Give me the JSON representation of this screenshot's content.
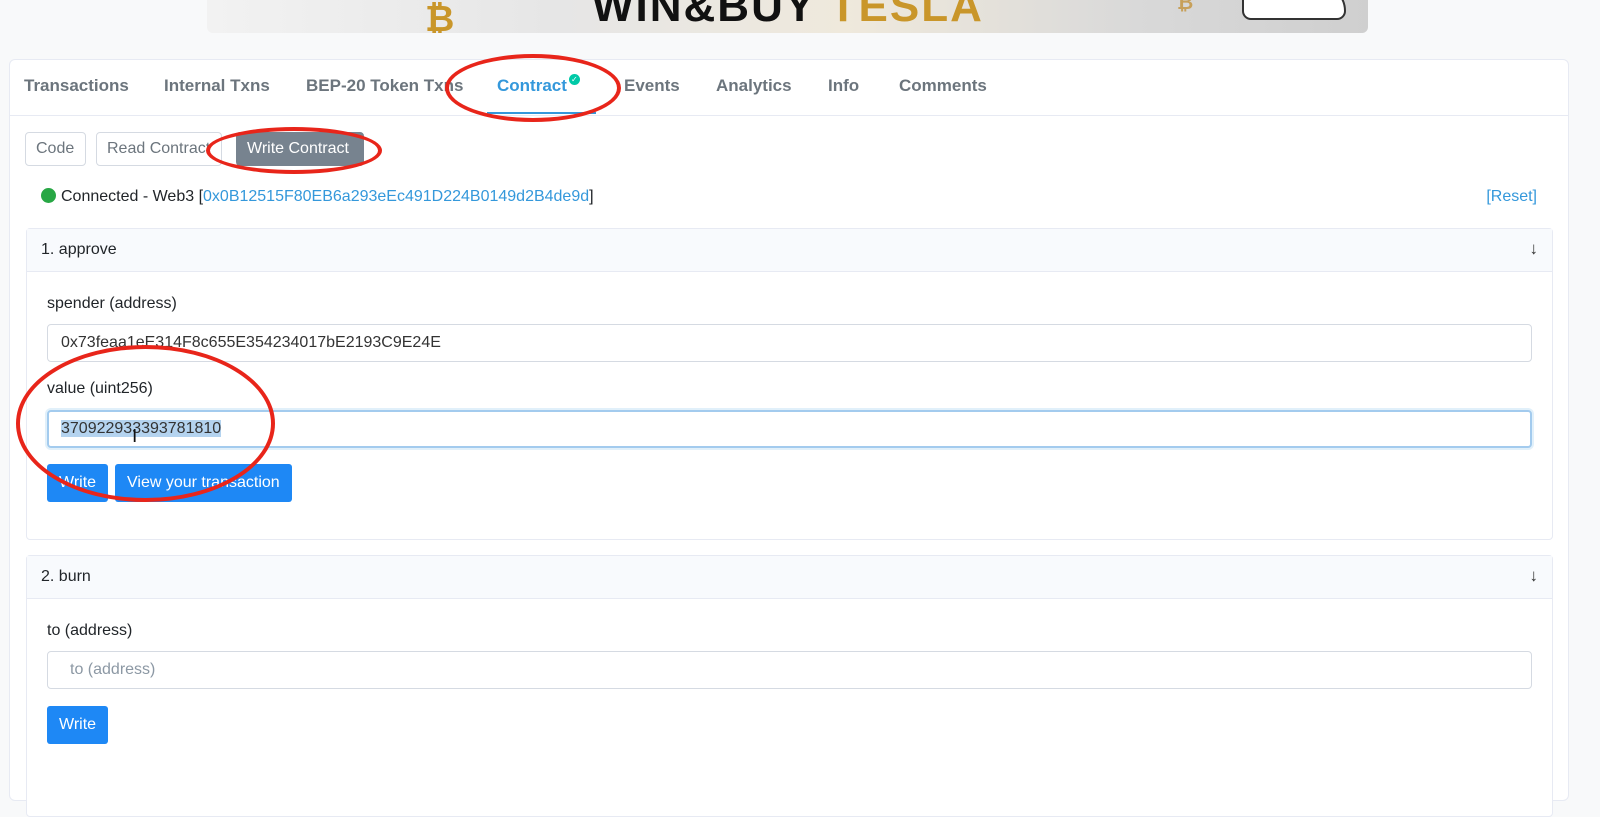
{
  "banner": {
    "headline_dark": "WIN&BUY",
    "headline_gold": "TESLA",
    "coin_symbol": "₿"
  },
  "tabs": [
    {
      "label": "Transactions"
    },
    {
      "label": "Internal Txns"
    },
    {
      "label": "BEP-20 Token Txns"
    },
    {
      "label": "Contract",
      "active": true,
      "verified_icon": "check-circle-icon"
    },
    {
      "label": "Events"
    },
    {
      "label": "Analytics"
    },
    {
      "label": "Info"
    },
    {
      "label": "Comments"
    }
  ],
  "subtabs": [
    {
      "label": "Code"
    },
    {
      "label": "Read Contract"
    },
    {
      "label": "Write Contract",
      "active": true
    }
  ],
  "connection": {
    "status_text": "Connected - Web3 [",
    "address": "0x0B12515F80EB6a293eEc491D224B0149d2B4de9d",
    "close_bracket": "]",
    "reset_label": "[Reset]"
  },
  "functions": [
    {
      "title": "1. approve",
      "fields": [
        {
          "label": "spender (address)",
          "value": "0x73feaa1eE314F8c655E354234017bE2193C9E24E"
        },
        {
          "label": "value (uint256)",
          "value": "370922933393781810",
          "selected": true
        }
      ],
      "buttons": [
        "Write",
        "View your transaction"
      ]
    },
    {
      "title": "2. burn",
      "fields": [
        {
          "label": "to (address)",
          "placeholder": "to (address)"
        }
      ],
      "buttons": [
        "Write"
      ]
    }
  ],
  "colors": {
    "accent": "#3498db",
    "button": "#1e88f5",
    "status_green": "#28a745",
    "annotation_red": "#e8251a"
  }
}
